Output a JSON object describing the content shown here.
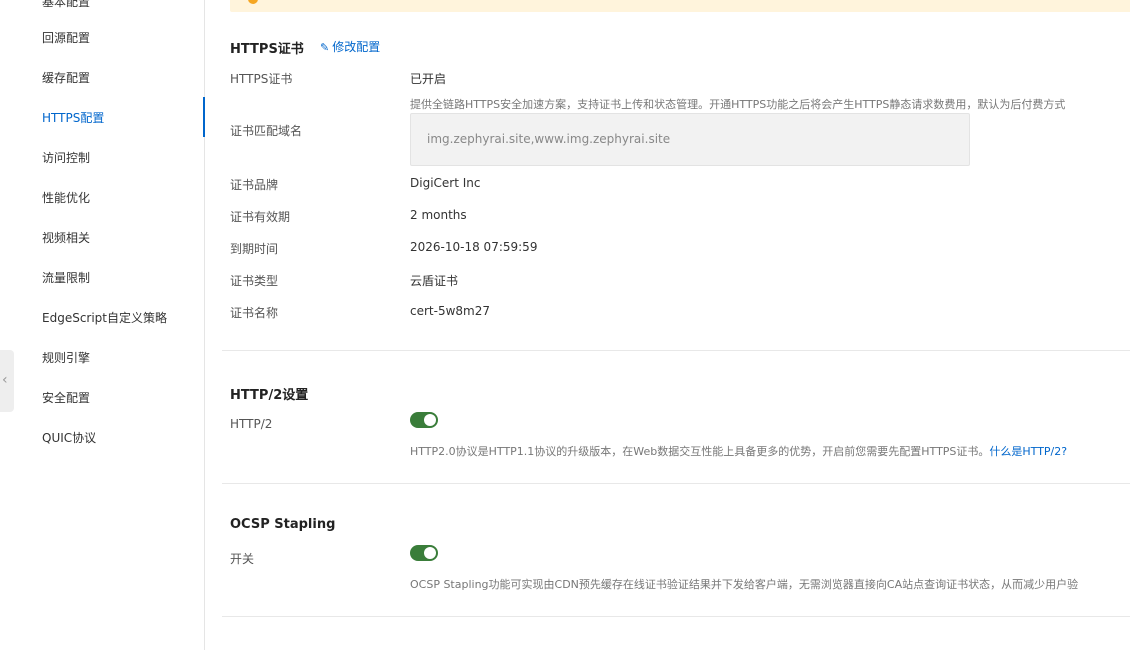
{
  "sidebar": {
    "items": [
      {
        "label": "基本配置"
      },
      {
        "label": "回源配置"
      },
      {
        "label": "缓存配置"
      },
      {
        "label": "HTTPS配置"
      },
      {
        "label": "访问控制"
      },
      {
        "label": "性能优化"
      },
      {
        "label": "视频相关"
      },
      {
        "label": "流量限制"
      },
      {
        "label": "EdgeScript自定义策略"
      },
      {
        "label": "规则引擎"
      },
      {
        "label": "安全配置"
      },
      {
        "label": "QUIC协议"
      }
    ],
    "active_index": 3,
    "collapse_icon": "chevron-left-icon"
  },
  "https": {
    "title": "HTTPS证书",
    "edit_label": "修改配置",
    "edit_icon": "pencil-icon",
    "status_label": "HTTPS证书",
    "status_value": "已开启",
    "description": "提供全链路HTTPS安全加速方案，支持证书上传和状态管理。开通HTTPS功能之后将会产生HTTPS静态请求数费用，默认为后付费方式",
    "domain_label": "证书匹配域名",
    "domain_value": "img.zephyrai.site,www.img.zephyrai.site",
    "brand_label": "证书品牌",
    "brand_value": "DigiCert Inc",
    "validity_label": "证书有效期",
    "validity_value": "2 months",
    "expiry_label": "到期时间",
    "expiry_value": "2026-10-18 07:59:59",
    "type_label": "证书类型",
    "type_value": "云盾证书",
    "name_label": "证书名称",
    "name_value": "cert-5w8m27"
  },
  "http2": {
    "title": "HTTP/2设置",
    "label": "HTTP/2",
    "enabled": true,
    "description": "HTTP2.0协议是HTTP1.1协议的升级版本，在Web数据交互性能上具备更多的优势，开启前您需要先配置HTTPS证书。",
    "link_label": "什么是HTTP/2?"
  },
  "ocsp": {
    "title": "OCSP Stapling",
    "label": "开关",
    "enabled": true,
    "description": "OCSP Stapling功能可实现由CDN预先缓存在线证书验证结果并下发给客户端，无需浏览器直接向CA站点查询证书状态，从而减少用户验"
  },
  "colors": {
    "accent": "#0066cc",
    "toggle_on": "#3a7d3a",
    "notice_bg": "#fff4dc"
  }
}
